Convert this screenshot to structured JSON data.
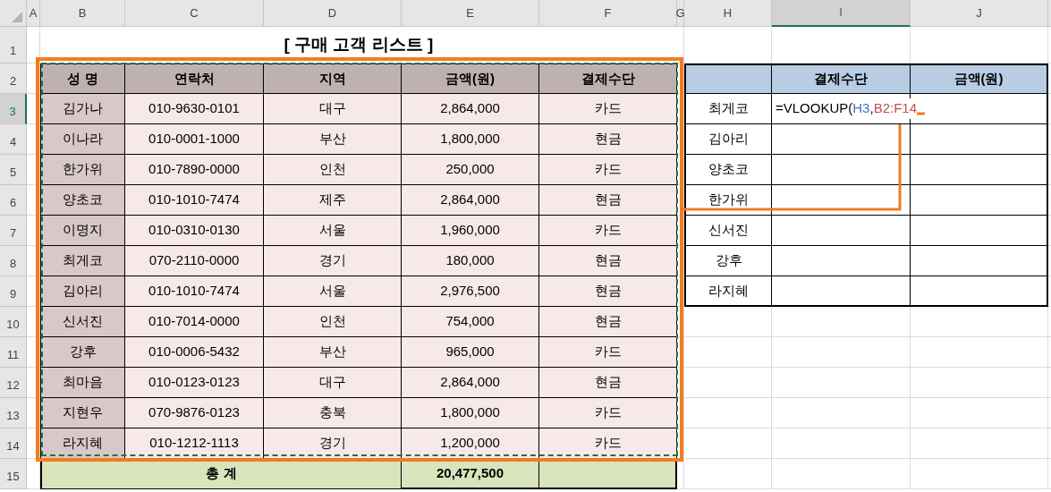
{
  "column_headers": [
    {
      "label": "A",
      "selected": false
    },
    {
      "label": "B",
      "selected": false
    },
    {
      "label": "C",
      "selected": false
    },
    {
      "label": "D",
      "selected": false
    },
    {
      "label": "E",
      "selected": false
    },
    {
      "label": "F",
      "selected": false
    },
    {
      "label": "G",
      "selected": false
    },
    {
      "label": "H",
      "selected": false
    },
    {
      "label": "I",
      "selected": true
    },
    {
      "label": "J",
      "selected": false
    }
  ],
  "row_headers": [
    {
      "label": "1",
      "selected": false
    },
    {
      "label": "2",
      "selected": false
    },
    {
      "label": "3",
      "selected": true
    },
    {
      "label": "4",
      "selected": false
    },
    {
      "label": "5",
      "selected": false
    },
    {
      "label": "6",
      "selected": false
    },
    {
      "label": "7",
      "selected": false
    },
    {
      "label": "8",
      "selected": false
    },
    {
      "label": "9",
      "selected": false
    },
    {
      "label": "10",
      "selected": false
    },
    {
      "label": "11",
      "selected": false
    },
    {
      "label": "12",
      "selected": false
    },
    {
      "label": "13",
      "selected": false
    },
    {
      "label": "14",
      "selected": false
    },
    {
      "label": "15",
      "selected": false
    }
  ],
  "title": "[ 구매 고객 리스트 ]",
  "customers": {
    "columns": [
      "성 명",
      "연락처",
      "지역",
      "금액(원)",
      "결제수단"
    ],
    "rows": [
      [
        "김가나",
        "010-9630-0101",
        "대구",
        "2,864,000",
        "카드"
      ],
      [
        "이나라",
        "010-0001-1000",
        "부산",
        "1,800,000",
        "현금"
      ],
      [
        "한가위",
        "010-7890-0000",
        "인천",
        "250,000",
        "카드"
      ],
      [
        "양초코",
        "010-1010-7474",
        "제주",
        "2,864,000",
        "현금"
      ],
      [
        "이명지",
        "010-0310-0130",
        "서울",
        "1,960,000",
        "카드"
      ],
      [
        "최게코",
        "070-2110-0000",
        "경기",
        "180,000",
        "현금"
      ],
      [
        "김아리",
        "010-1010-7474",
        "서울",
        "2,976,500",
        "현금"
      ],
      [
        "신서진",
        "010-7014-0000",
        "인천",
        "754,000",
        "현금"
      ],
      [
        "강후",
        "010-0006-5432",
        "부산",
        "965,000",
        "카드"
      ],
      [
        "최마음",
        "010-0123-0123",
        "대구",
        "2,864,000",
        "현금"
      ],
      [
        "지현우",
        "070-9876-0123",
        "충북",
        "1,800,000",
        "카드"
      ],
      [
        "라지혜",
        "010-1212-1113",
        "경기",
        "1,200,000",
        "카드"
      ]
    ],
    "total": {
      "label": "총 계",
      "amount": "20,477,500"
    }
  },
  "lookup": {
    "columns": [
      "결제수단",
      "금액(원)"
    ],
    "rows": [
      {
        "name": "최게코",
        "formula": [
          {
            "text": "=VLOOKUP(",
            "color": "#000000"
          },
          {
            "text": "H3",
            "color": "#4472c4"
          },
          {
            "text": ",",
            "color": "#000000"
          },
          {
            "text": "B2:F14",
            "color": "#c0504d"
          }
        ]
      },
      {
        "name": "김아리"
      },
      {
        "name": "양초코"
      },
      {
        "name": "한가위"
      },
      {
        "name": "신서진"
      },
      {
        "name": "강후"
      },
      {
        "name": "라지혜"
      }
    ]
  }
}
